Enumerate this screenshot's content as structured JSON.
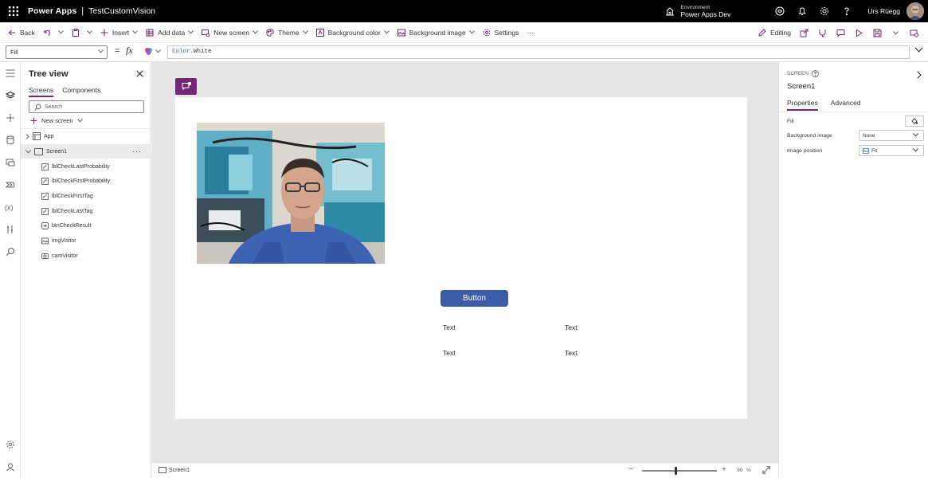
{
  "titlebar": {
    "app_name": "Power Apps",
    "separator": "|",
    "project_name": "TestCustomVision",
    "environment_label": "Environment",
    "environment_name": "Power Apps Dev",
    "user_name": "Urs Rüegg"
  },
  "commandbar": {
    "back": "Back",
    "insert": "Insert",
    "add_data": "Add data",
    "new_screen": "New screen",
    "theme": "Theme",
    "background_color": "Background color",
    "background_image": "Background image",
    "settings": "Settings",
    "more": "···",
    "editing": "Editing"
  },
  "formulabar": {
    "property": "Fill",
    "equals": "=",
    "fx": "fx",
    "formula_keyword": "Color",
    "formula_rest": ".White"
  },
  "tree": {
    "title": "Tree view",
    "tabs": [
      "Screens",
      "Components"
    ],
    "search_placeholder": "Search",
    "new_screen": "New screen",
    "app_node": "App",
    "screen_node": "Screen1",
    "screen_more": "···",
    "controls": [
      {
        "name": "lblCheckLastProbability",
        "icon": "label-icon"
      },
      {
        "name": "lblCheckFirstProbability",
        "icon": "label-icon"
      },
      {
        "name": "lblCheckFirstTag",
        "icon": "label-icon"
      },
      {
        "name": "lblCheckLastTag",
        "icon": "label-icon"
      },
      {
        "name": "btnCheckResult",
        "icon": "button-control-icon"
      },
      {
        "name": "imgVisitor",
        "icon": "image-icon"
      },
      {
        "name": "camVisitor",
        "icon": "camera-icon"
      }
    ]
  },
  "canvas": {
    "button_text": "Button",
    "labels": [
      "Text",
      "Text",
      "Text",
      "Text"
    ]
  },
  "statusbar": {
    "screen": "Screen1",
    "zoom_minus": "−",
    "zoom_plus": "+",
    "zoom_value": "90",
    "zoom_unit": "%",
    "zoom_level": 0.9
  },
  "properties": {
    "kind": "SCREEN",
    "name": "Screen1",
    "tabs": [
      "Properties",
      "Advanced"
    ],
    "fill_label": "Fill",
    "background_image_label": "Background image",
    "background_image_value": "None",
    "image_position_label": "Image position",
    "image_position_value": "Fit"
  },
  "colors": {
    "titlebar": "#000000",
    "accent": "#742774",
    "app_button": "#3b5da8",
    "canvas_bg": "#e6e6e6",
    "screen_fill": "#ffffff"
  }
}
